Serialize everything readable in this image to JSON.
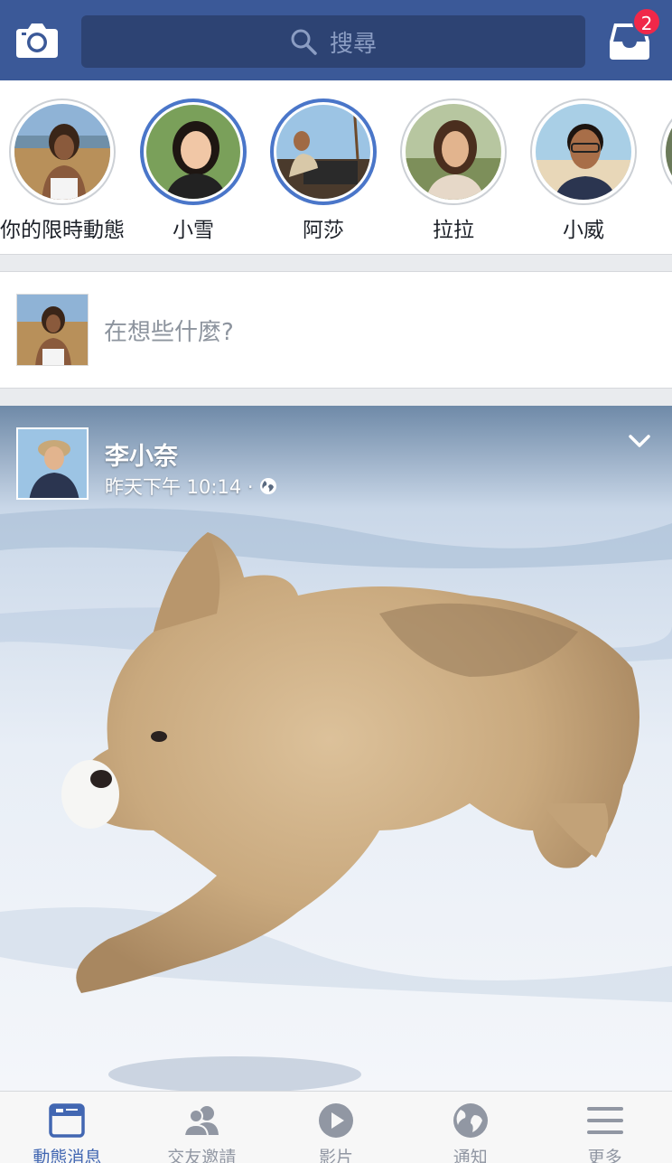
{
  "header": {
    "search_placeholder": "搜尋",
    "inbox_badge": "2"
  },
  "stories": [
    {
      "name": "你的限時動態",
      "active": false
    },
    {
      "name": "小雪",
      "active": true
    },
    {
      "name": "阿莎",
      "active": true
    },
    {
      "name": "拉拉",
      "active": false
    },
    {
      "name": "小威",
      "active": false
    }
  ],
  "composer": {
    "prompt": "在想些什麼?"
  },
  "post": {
    "author": "李小奈",
    "time": "昨天下午 10:14 ·",
    "privacy_icon": "globe-icon"
  },
  "bottom_nav": [
    {
      "label": "動態消息",
      "icon": "news-feed-icon",
      "active": true
    },
    {
      "label": "交友邀請",
      "icon": "friend-requests-icon",
      "active": false
    },
    {
      "label": "影片",
      "icon": "video-play-icon",
      "active": false
    },
    {
      "label": "通知",
      "icon": "globe-notifications-icon",
      "active": false
    },
    {
      "label": "更多",
      "icon": "menu-icon",
      "active": false
    }
  ],
  "colors": {
    "brand": "#3b5998",
    "active_tab": "#4267b2",
    "badge": "#f02849"
  }
}
